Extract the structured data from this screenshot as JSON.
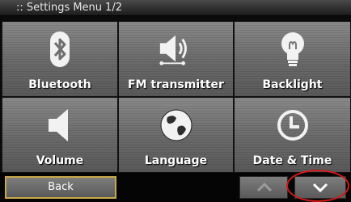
{
  "title": {
    "menu_name": ":: Settings Menu",
    "page_indicator": "1/2"
  },
  "tiles": [
    {
      "label": "Bluetooth",
      "icon": "bluetooth-icon"
    },
    {
      "label": "FM transmitter",
      "icon": "speaker-icon"
    },
    {
      "label": "Backlight",
      "icon": "light-bulb-icon"
    },
    {
      "label": "Volume",
      "icon": "volume-icon"
    },
    {
      "label": "Language",
      "icon": "globe-icon"
    },
    {
      "label": "Date & Time",
      "icon": "clock-icon"
    }
  ],
  "bottom": {
    "back_label": "Back",
    "up_icon": "chevron-up-icon",
    "down_icon": "chevron-down-icon"
  },
  "colors": {
    "highlight_ring": "#d51818",
    "back_border": "#caa84a"
  }
}
